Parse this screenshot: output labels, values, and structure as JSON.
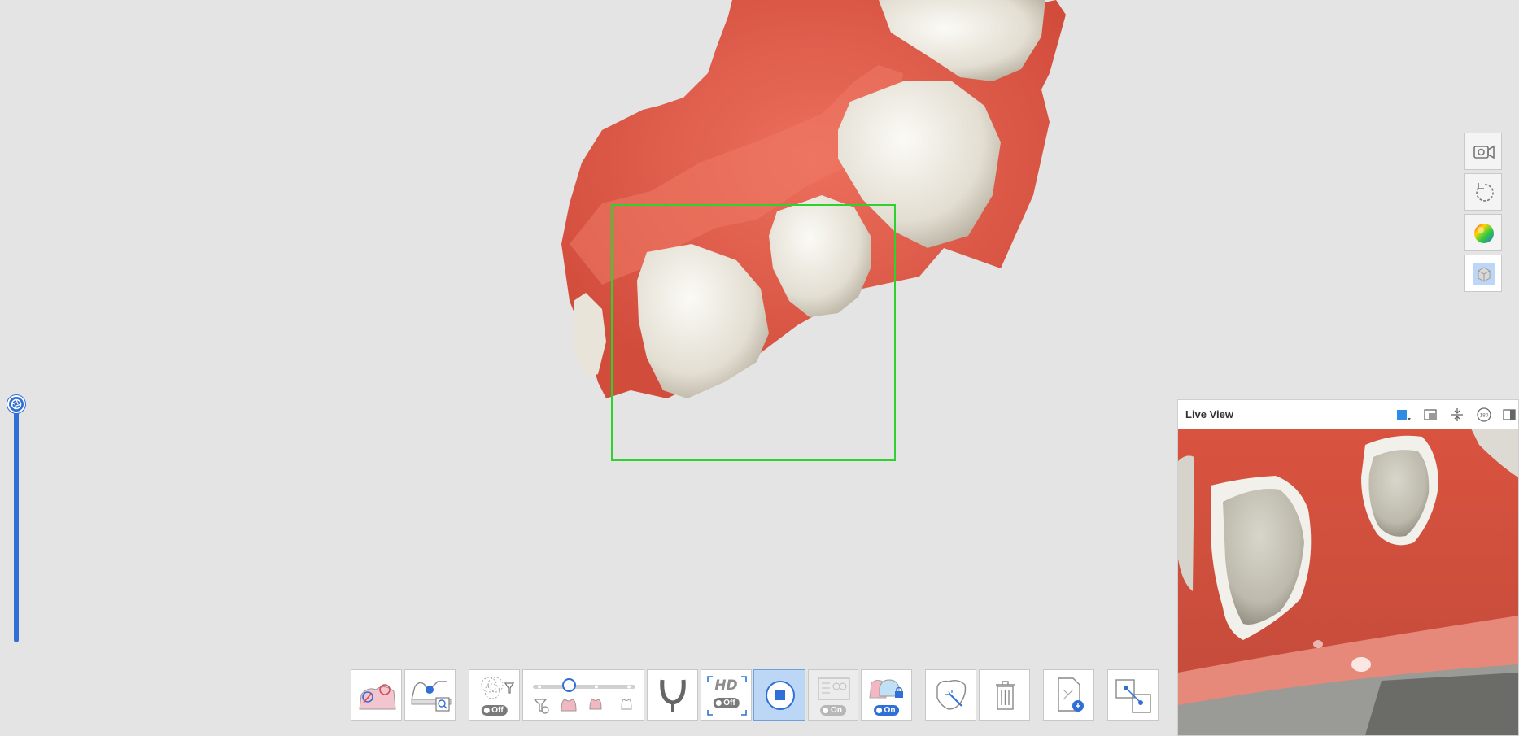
{
  "viewport": {
    "scan_box_color": "#2fd12f",
    "gum_color": "#e05a47",
    "tooth_color": "#ece8df"
  },
  "depth_slider": {
    "icon": "aperture-icon",
    "color": "#2f6fd6"
  },
  "side_tools": [
    {
      "name": "camera-record-icon"
    },
    {
      "name": "rotate-icon"
    },
    {
      "name": "color-map-icon"
    },
    {
      "name": "view-cube-icon"
    }
  ],
  "toolbar": {
    "hd_text": "HD",
    "filter_toggle": "Off",
    "hd_toggle": "Off",
    "ai_toggle": "On",
    "lock_toggle": "On",
    "slider_level": 0.5,
    "accent": "#2f6fd6"
  },
  "live_view": {
    "title": "Live View",
    "tools": [
      "color-swatch-icon",
      "window-icon",
      "flip-vertical-icon",
      "rotate-180-icon",
      "dock-icon"
    ],
    "rotate_text": "180"
  }
}
